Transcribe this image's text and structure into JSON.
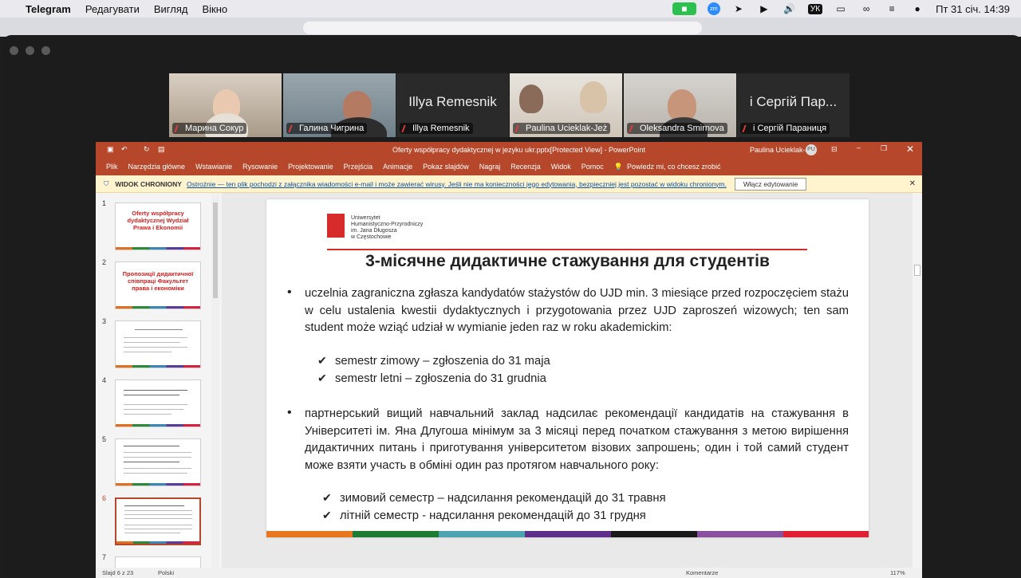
{
  "menubar": {
    "app": "Telegram",
    "items": [
      "Редагувати",
      "Вигляд",
      "Вікно"
    ],
    "lang": "УК",
    "datetime": "Пт 31 січ.  14:39"
  },
  "participants": [
    {
      "name": "Марина Сокур",
      "big": ""
    },
    {
      "name": "Галина Чигрина",
      "big": ""
    },
    {
      "name": "Illya Remesnik",
      "big": "Illya Remesnik"
    },
    {
      "name": "Paulina Ucieklak-Jeż",
      "big": ""
    },
    {
      "name": "Oleksandra Smirnova",
      "big": ""
    },
    {
      "name": "і Сергій Параниця",
      "big": "і Сергій Пар..."
    }
  ],
  "ppt": {
    "title": "Oferty współpracy dydaktycznej  w jezyku ukr.pptx[Protected View]  -  PowerPoint",
    "user": "Paulina Ucieklak-Jeż",
    "user_initials": "PU",
    "ribbon": [
      "Plik",
      "Narzędzia główne",
      "Wstawianie",
      "Rysowanie",
      "Projektowanie",
      "Przejścia",
      "Animacje",
      "Pokaz slajdów",
      "Nagraj",
      "Recenzja",
      "Widok",
      "Pomoc",
      "Powiedz mi, co chcesz zrobić"
    ],
    "protected": {
      "label": "WIDOK CHRONIONY",
      "text": "Ostrożnie — ten plik pochodzi z załącznika wiadomości e-mail i może zawierać wirusy. Jeśli nie ma konieczności jego edytowania, bezpieczniej jest pozostać w widoku chronionym.",
      "button": "Włącz edytowanie"
    },
    "thumbs": [
      {
        "n": "1",
        "text": "Oferty współpracy dydaktycznej Wydział Prawa i Ekonomii"
      },
      {
        "n": "2",
        "text": "Пропозиції дидактичної співпраці Факультет права і економіки"
      },
      {
        "n": "3",
        "text": ""
      },
      {
        "n": "4",
        "text": ""
      },
      {
        "n": "5",
        "text": ""
      },
      {
        "n": "6",
        "text": ""
      },
      {
        "n": "7",
        "text": ""
      }
    ],
    "status": {
      "slide": "Slajd 6 z 23",
      "lang": "Polski",
      "comments": "Komentarze",
      "zoom": "117%"
    }
  },
  "slide": {
    "uni": [
      "Uniwersytet",
      "Humanistyczno-Przyrodniczy",
      "im. Jana Długosza",
      "w Częstochowie"
    ],
    "title": "3-місячне дидактичне стажування для студентів",
    "p1": "uczelnia zagraniczna zgłasza kandydatów stażystów do UJD min. 3 miesiące przed rozpoczęciem stażu w celu ustalenia kwestii dydaktycznych i przygotowania przez UJD zaproszeń wizowych; ten sam student może wziąć udział w wymianie jeden raz w roku akademickim:",
    "s1": "semestr zimowy – zgłoszenia do 31 maja",
    "s2": "semestr letni – zgłoszenia do 31 grudnia",
    "p2": "партнерський вищий навчальний заклад надсилає рекомендації кандидатів на стажування в Університеті ім. Яна Длугоша мінімум за 3 місяці перед початком стажування з метою вирішення дидактичних питань і приготування університетом візових запрошень; один і той самий студент може взяти участь в обміні один раз протягом навчального року:",
    "s3": "зимовий семестр – надсилання рекомендацій до 31 травня",
    "s4": "літній семестр - надсилання рекомендацій до 31 грудня"
  }
}
